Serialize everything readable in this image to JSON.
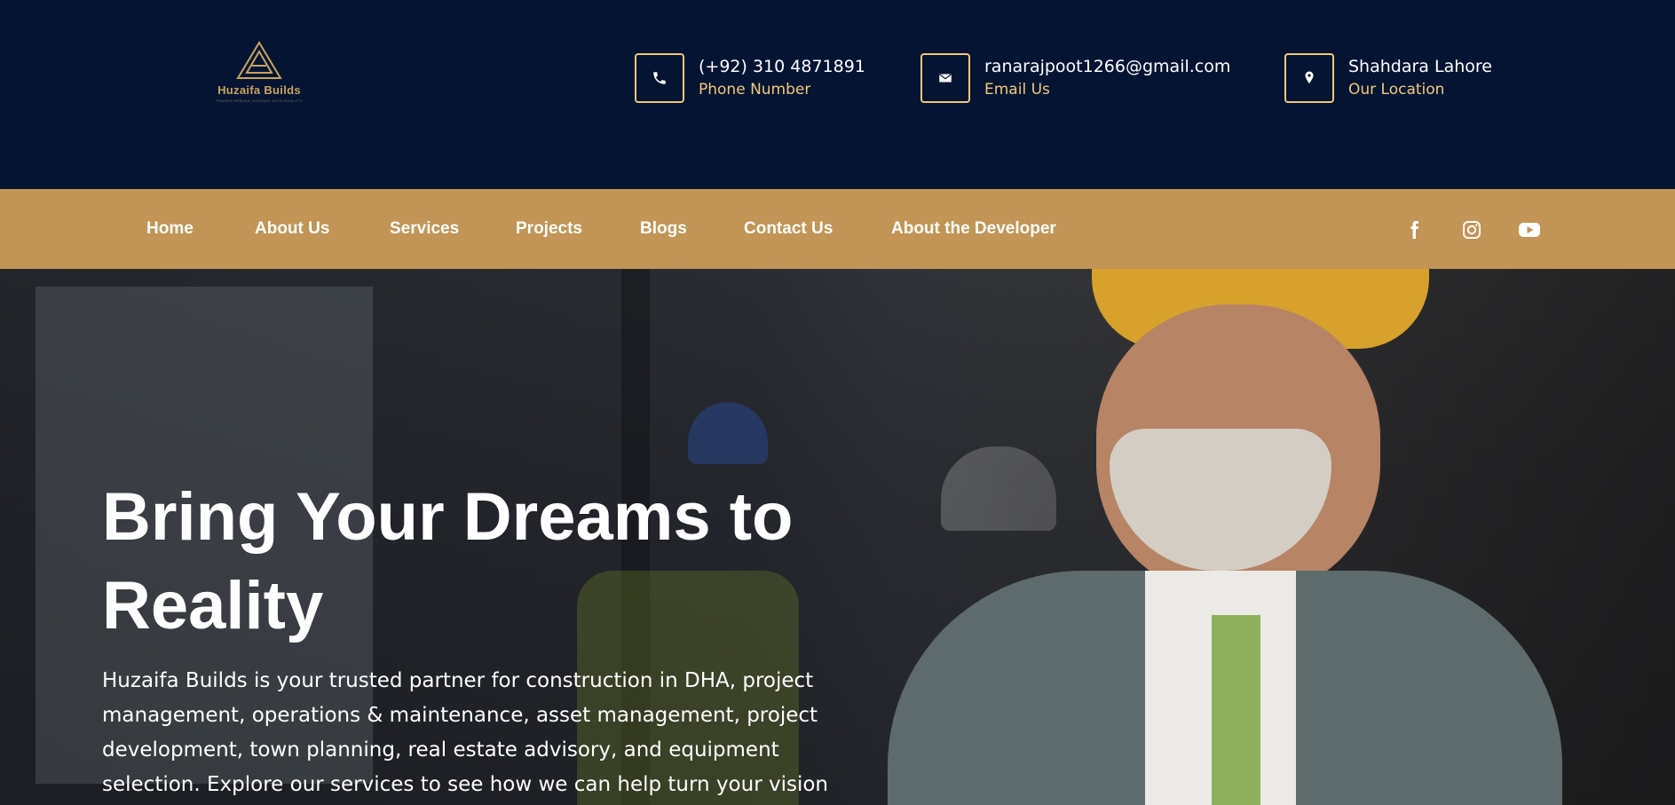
{
  "brand": {
    "name": "Huzaifa Builds",
    "tagline": "Transforming visions into reality"
  },
  "contacts": [
    {
      "main": "(+92) 310 4871891",
      "sub": "Phone Number",
      "icon": "phone-icon"
    },
    {
      "main": "ranarajpoot1266@gmail.com",
      "sub": "Email Us",
      "icon": "email-icon"
    },
    {
      "main": "Shahdara Lahore",
      "sub": "Our Location",
      "icon": "location-pin-icon"
    }
  ],
  "nav": {
    "items": [
      "Home",
      "About Us",
      "Services",
      "Projects",
      "Blogs",
      "Contact Us",
      "About the Developer"
    ]
  },
  "social": [
    "facebook-icon",
    "instagram-icon",
    "youtube-icon"
  ],
  "hero": {
    "title": "Bring Your Dreams to Reality",
    "description": "Huzaifa Builds is your trusted partner for construction in DHA, project management, operations & maintenance, asset management, project development, town planning, real estate advisory, and equipment selection. Explore our services to see how we can help turn your vision into reality."
  },
  "colors": {
    "navy": "#051433",
    "gold": "#c29455",
    "accent": "#f1c97a"
  }
}
